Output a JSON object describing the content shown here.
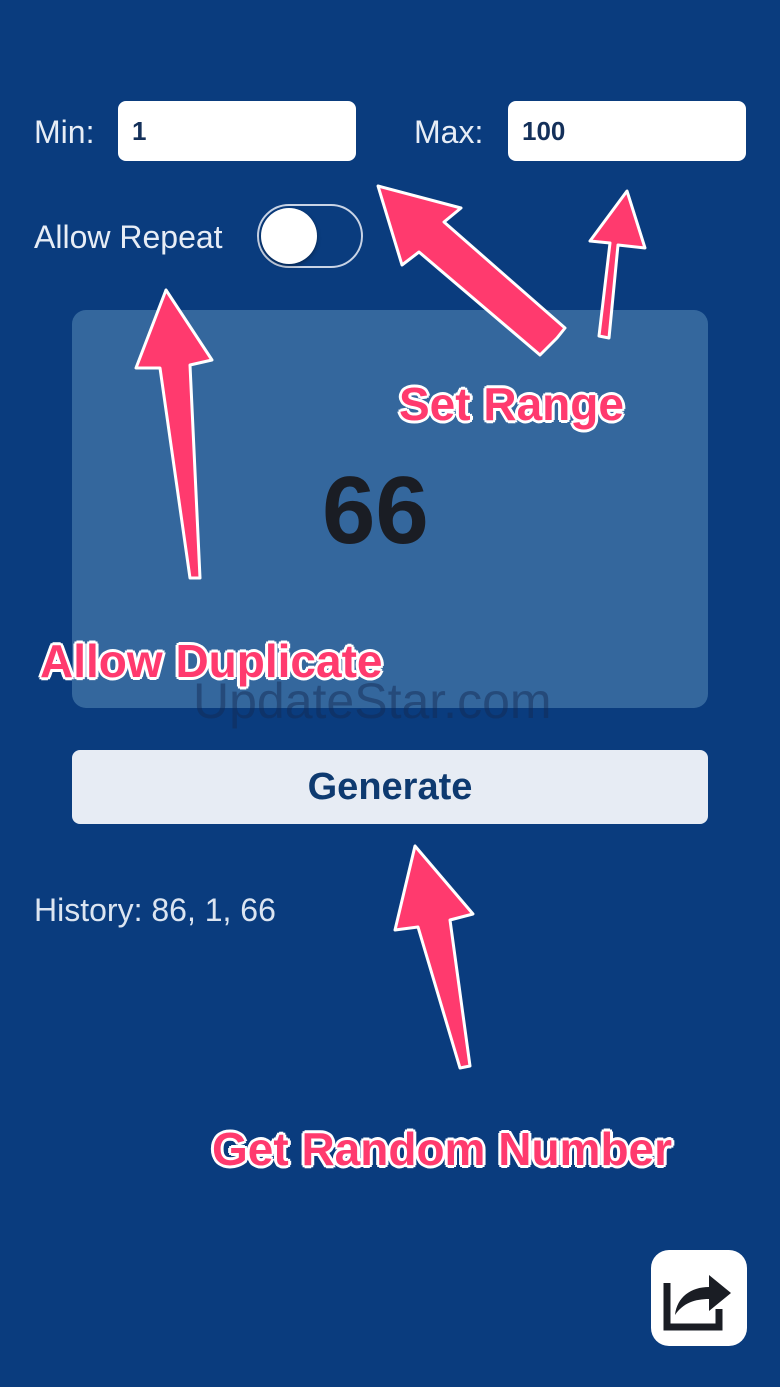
{
  "range": {
    "min_label": "Min:",
    "min_value": "1",
    "max_label": "Max:",
    "max_value": "100"
  },
  "repeat": {
    "label": "Allow Repeat",
    "enabled": false
  },
  "result": {
    "value": "66"
  },
  "generate_button": {
    "label": "Generate"
  },
  "history": {
    "text": "History: 86, 1, 66"
  },
  "annotations": {
    "set_range": "Set Range",
    "allow_duplicate": "Allow Duplicate",
    "get_random_number": "Get Random Number"
  },
  "watermark": {
    "text": "UpdateStar.com"
  },
  "share": {
    "icon": "share-icon"
  },
  "colors": {
    "background": "#0a3c7e",
    "panel": "#34679d",
    "annotation": "#ff3a6e",
    "button": "#e7ecf4"
  }
}
